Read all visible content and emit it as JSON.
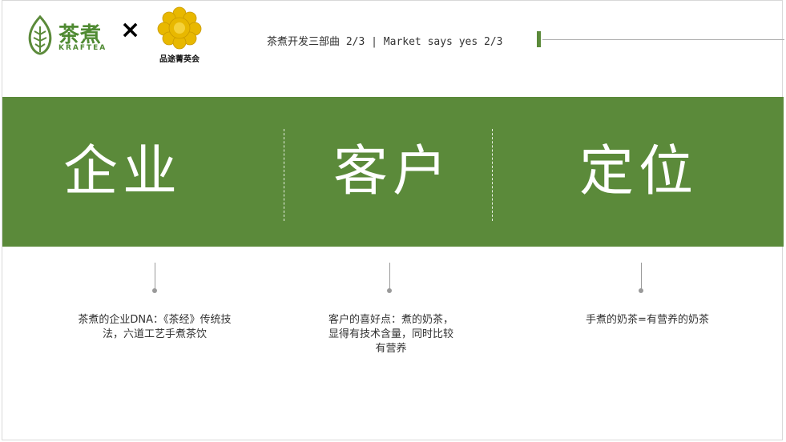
{
  "header": {
    "logo_left_cn": "茶煮",
    "logo_left_en": "KRAFTEA",
    "separator": "×",
    "logo_right_text": "品途菁英会",
    "section_title": "茶煮开发三部曲 2/3 | Market says yes 2/3"
  },
  "band": {
    "items": [
      {
        "title": "企业"
      },
      {
        "title": "客户"
      },
      {
        "title": "定位"
      }
    ]
  },
  "details": [
    {
      "text": "茶煮的企业DNA：《茶经》传统技法，六道工艺手煮茶饮"
    },
    {
      "text": "客户的喜好点：煮的奶茶，显得有技术含量，同时比较有营养"
    },
    {
      "text": "手煮的奶茶=有营养的奶茶"
    }
  ],
  "colors": {
    "brand_green": "#5b8a3a",
    "logo_gold": "#e8b800"
  }
}
